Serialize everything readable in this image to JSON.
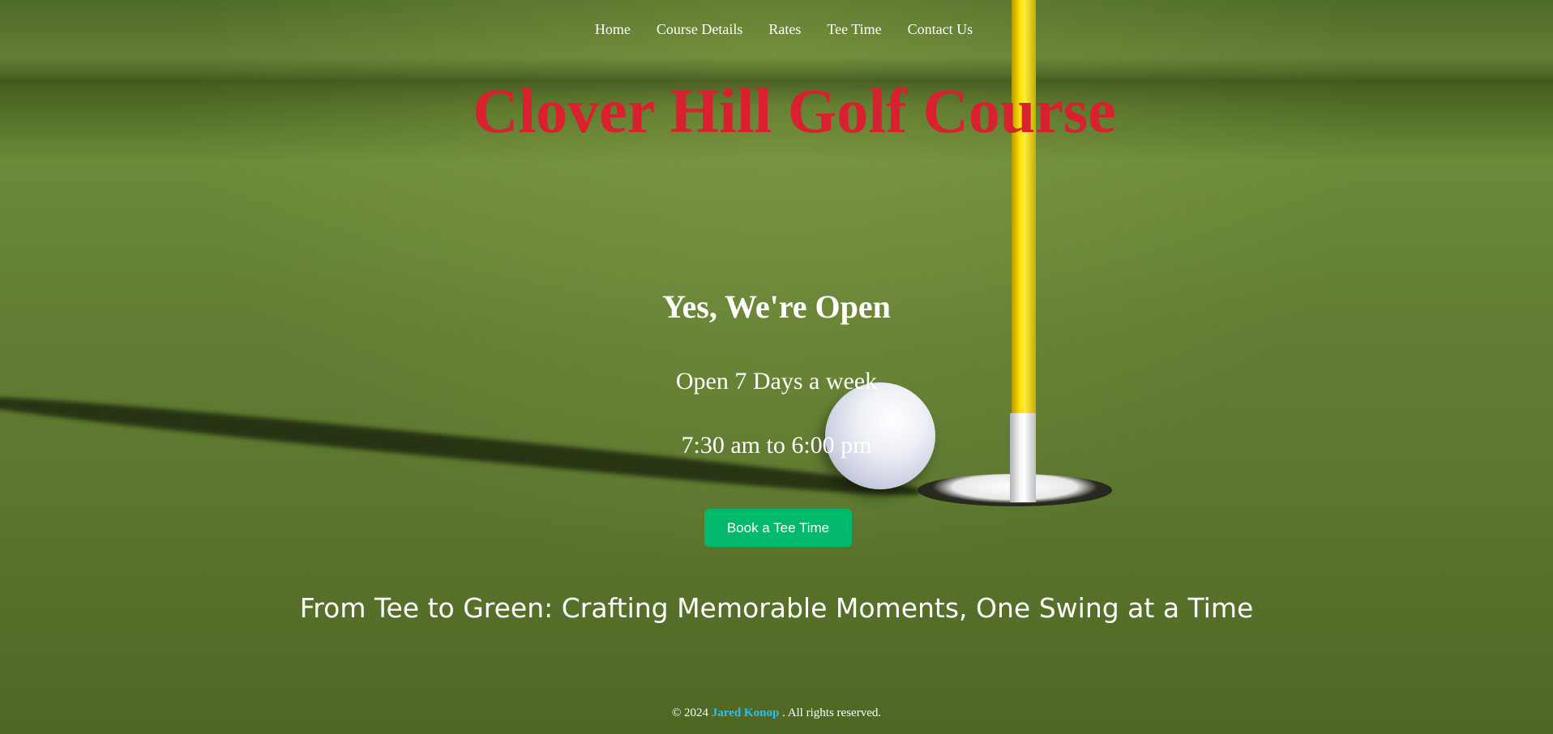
{
  "nav": {
    "items": [
      {
        "label": "Home"
      },
      {
        "label": "Course Details"
      },
      {
        "label": "Rates"
      },
      {
        "label": "Tee Time"
      },
      {
        "label": "Contact Us"
      }
    ]
  },
  "hero": {
    "title": "Clover Hill Golf Course",
    "open_heading": "Yes, We're Open",
    "days": "Open 7 Days a week",
    "hours": "7:30 am to 6:00 pm",
    "book_button": "Book a Tee Time",
    "tagline": "From Tee to Green: Crafting Memorable Moments, One Swing at a Time"
  },
  "footer": {
    "copyright": "© 2024",
    "author": "Jared Konop",
    "rights": ". All rights reserved."
  },
  "colors": {
    "title": "#d8202f",
    "button": "#00b96c",
    "author_link": "#1fc3ff",
    "text": "#ffffff"
  }
}
